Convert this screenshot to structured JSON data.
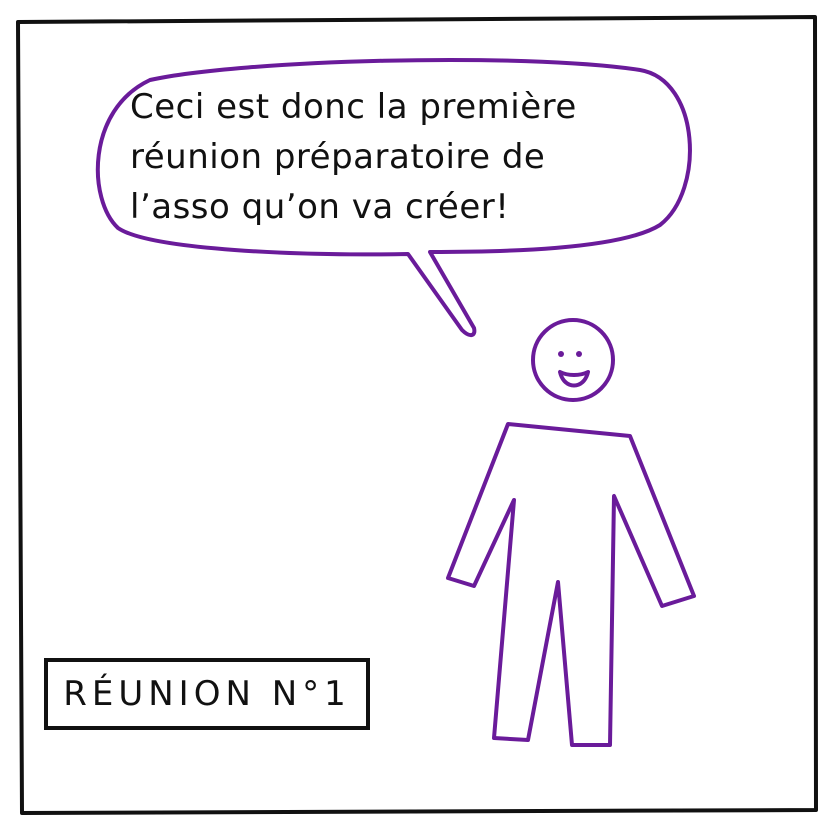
{
  "speech_bubble": {
    "lines": [
      "Ceci est donc la première",
      "réunion préparatoire de",
      "l’asso qu’on va créer!"
    ]
  },
  "caption": {
    "label": "RÉUNION N°1"
  },
  "colors": {
    "ink": "#111111",
    "character": "#6a1b9a",
    "background": "#ffffff"
  }
}
